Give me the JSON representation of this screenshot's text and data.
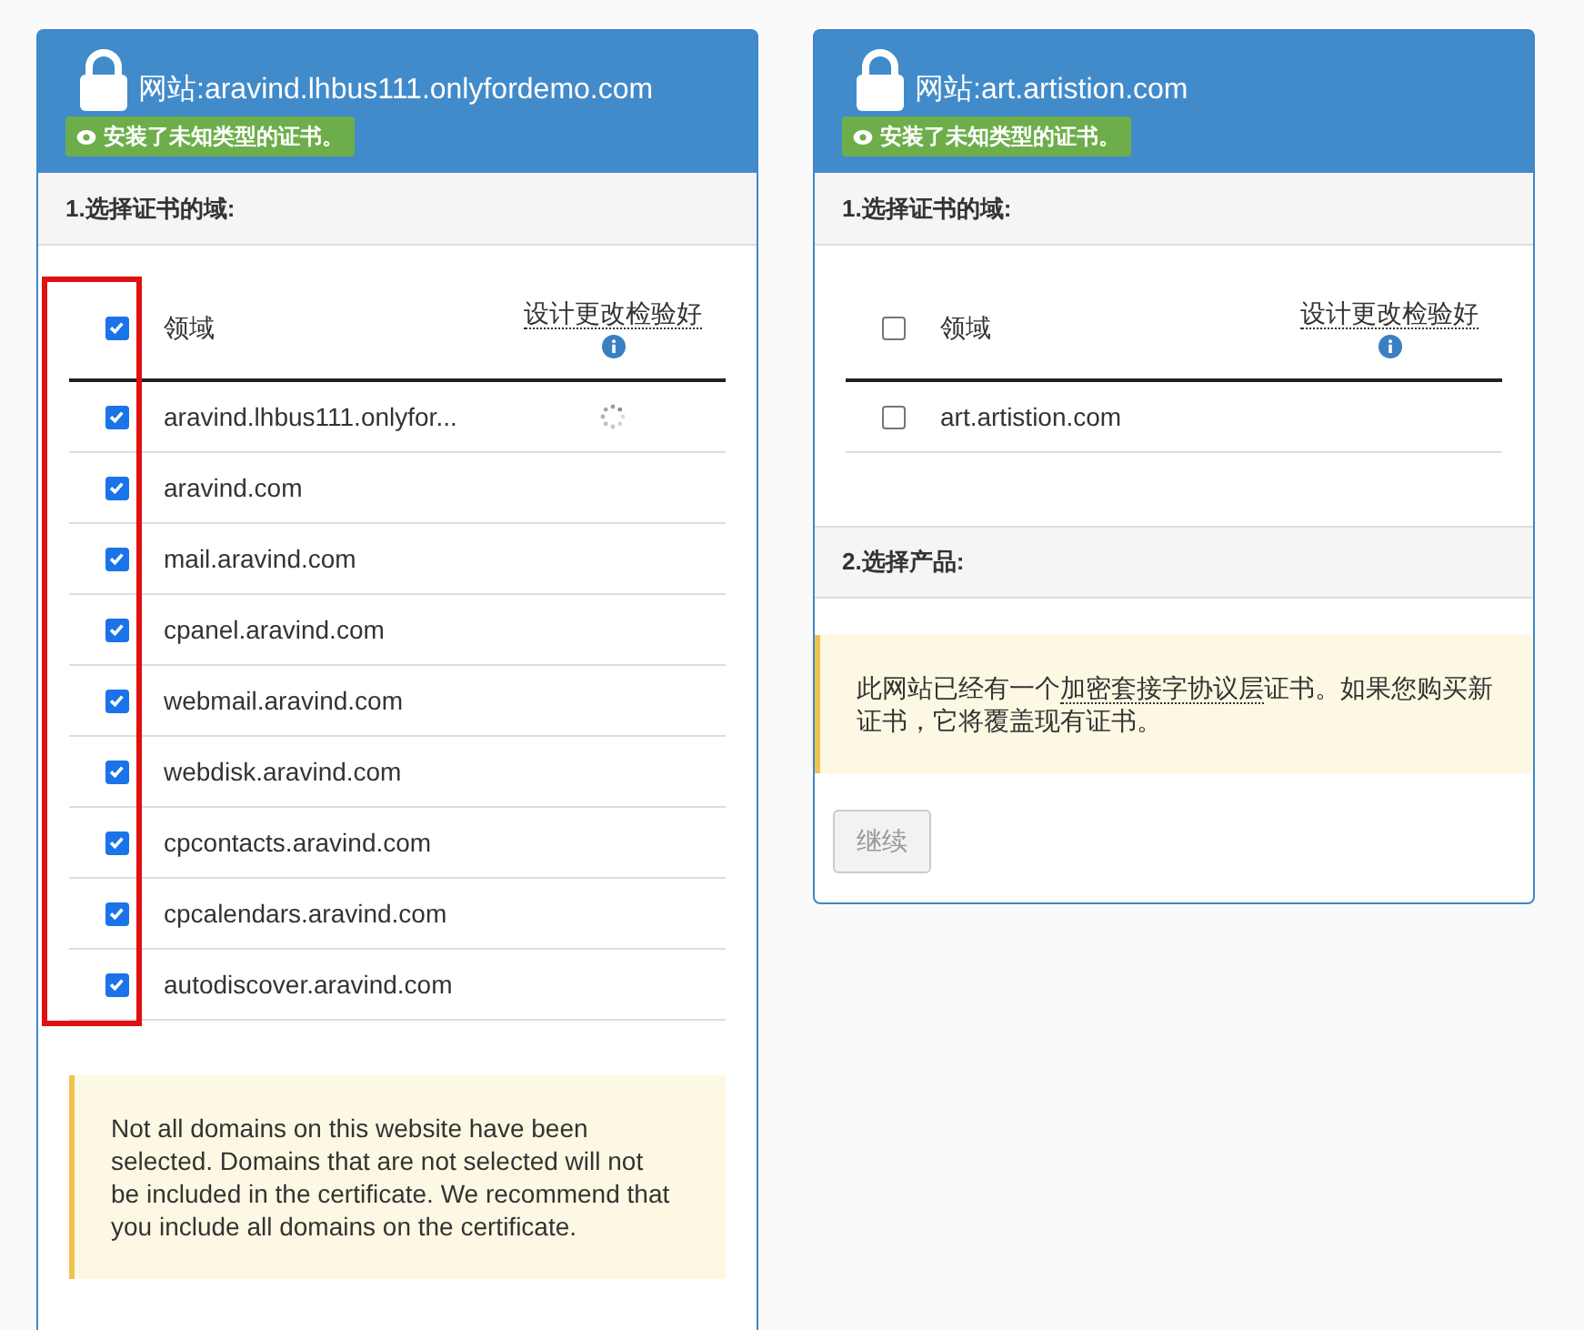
{
  "cards": [
    {
      "title": "网站:aravind.lhbus111.onlyfordemo.com",
      "badge": "安装了未知类型的证书。",
      "section_1": "1.选择证书的域:",
      "select_column_highlighted": true,
      "table": {
        "select_all_checked": true,
        "columns": [
          "领域",
          "设计更改检验好"
        ],
        "rows": [
          {
            "domain": "aravind.lhbus111.onlyfor...",
            "checked": true,
            "loading": true
          },
          {
            "domain": "aravind.com",
            "checked": true,
            "loading": false
          },
          {
            "domain": "mail.aravind.com",
            "checked": true,
            "loading": false
          },
          {
            "domain": "cpanel.aravind.com",
            "checked": true,
            "loading": false
          },
          {
            "domain": "webmail.aravind.com",
            "checked": true,
            "loading": false
          },
          {
            "domain": "webdisk.aravind.com",
            "checked": true,
            "loading": false
          },
          {
            "domain": "cpcontacts.aravind.com",
            "checked": true,
            "loading": false
          },
          {
            "domain": "cpcalendars.aravind.com",
            "checked": true,
            "loading": false
          },
          {
            "domain": "autodiscover.aravind.com",
            "checked": true,
            "loading": false
          }
        ]
      },
      "warning": {
        "before": "Not all domains on this website have been selected. Domains that are not selected will not be included in the certificate. We recommend that you include all domains on the certificate."
      }
    },
    {
      "title": "网站:art.artistion.com",
      "badge": "安装了未知类型的证书。",
      "section_1": "1.选择证书的域:",
      "select_column_highlighted": false,
      "table": {
        "select_all_checked": false,
        "columns": [
          "领域",
          "设计更改检验好"
        ],
        "rows": [
          {
            "domain": "art.artistion.com",
            "checked": false,
            "loading": false
          }
        ]
      },
      "section_2": "2.选择产品:",
      "warning": {
        "before": "此网站已经有一个",
        "term": "加密套接字协议层",
        "after": "证书。如果您购买新证书，它将覆盖现有证书。"
      },
      "button": {
        "label": "继续",
        "disabled": true
      }
    }
  ]
}
